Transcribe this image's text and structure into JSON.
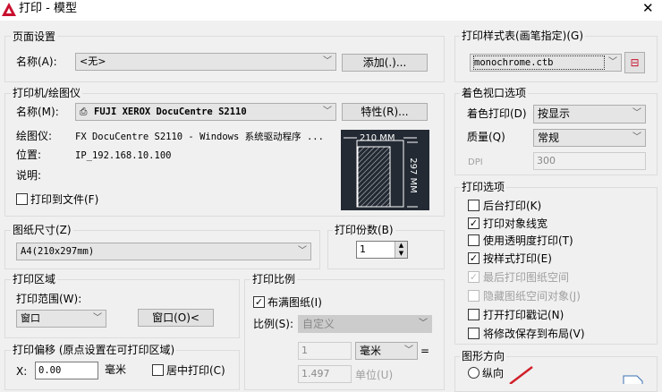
{
  "window": {
    "title": "打印 - 模型",
    "close": "✕"
  },
  "page_setup": {
    "title": "页面设置",
    "name_label": "名称(A):",
    "name_value": "<无>",
    "add_button": "添加(.)..."
  },
  "printer": {
    "title": "打印机/绘图仪",
    "name_label": "名称(M):",
    "name_value": "FUJI XEROX DocuCentre S2110",
    "properties_button": "特性(R)...",
    "plotter_label": "绘图仪:",
    "plotter_value": "FX DocuCentre S2110 - Windows 系统驱动程序 ...",
    "location_label": "位置:",
    "location_value": "IP_192.168.10.100",
    "description_label": "说明:",
    "print_to_file": "打印到文件(F)",
    "preview_width": "210 MM",
    "preview_height": "297 MM"
  },
  "paper_size": {
    "title": "图纸尺寸(Z)",
    "value": "A4(210x297mm)"
  },
  "copies": {
    "title": "打印份数(B)",
    "value": "1"
  },
  "plot_area": {
    "title": "打印区域",
    "range_label": "打印范围(W):",
    "range_value": "窗口",
    "window_button": "窗口(O)<"
  },
  "plot_offset": {
    "title": "打印偏移 (原点设置在可打印区域)",
    "x_label": "X:",
    "x_value": "0.00",
    "unit": "毫米",
    "center_label": "居中打印(C)"
  },
  "plot_scale": {
    "title": "打印比例",
    "fit_label": "布满图纸(I)",
    "scale_label": "比例(S):",
    "scale_value": "自定义",
    "value1": "1",
    "unit_value": "毫米",
    "equals": "=",
    "value2": "1.497",
    "units_label": "单位(U)"
  },
  "style_table": {
    "title": "打印样式表(画笔指定)(G)",
    "value": "monochrome.ctb"
  },
  "shaded": {
    "title": "着色视口选项",
    "shade_label": "着色打印(D)",
    "shade_value": "按显示",
    "quality_label": "质量(Q)",
    "quality_value": "常规",
    "dpi_label": "DPI",
    "dpi_value": "300"
  },
  "options": {
    "title": "打印选项",
    "items": [
      {
        "label": "后台打印(K)",
        "checked": false,
        "disabled": false
      },
      {
        "label": "打印对象线宽",
        "checked": true,
        "disabled": false
      },
      {
        "label": "使用透明度打印(T)",
        "checked": false,
        "disabled": false
      },
      {
        "label": "按样式打印(E)",
        "checked": true,
        "disabled": false
      },
      {
        "label": "最后打印图纸空间",
        "checked": true,
        "disabled": true
      },
      {
        "label": "隐藏图纸空间对象(J)",
        "checked": false,
        "disabled": true
      },
      {
        "label": "打开打印戳记(N)",
        "checked": false,
        "disabled": false
      },
      {
        "label": "将修改保存到布局(V)",
        "checked": false,
        "disabled": false
      }
    ]
  },
  "orientation": {
    "title": "图形方向",
    "portrait": "纵向"
  }
}
